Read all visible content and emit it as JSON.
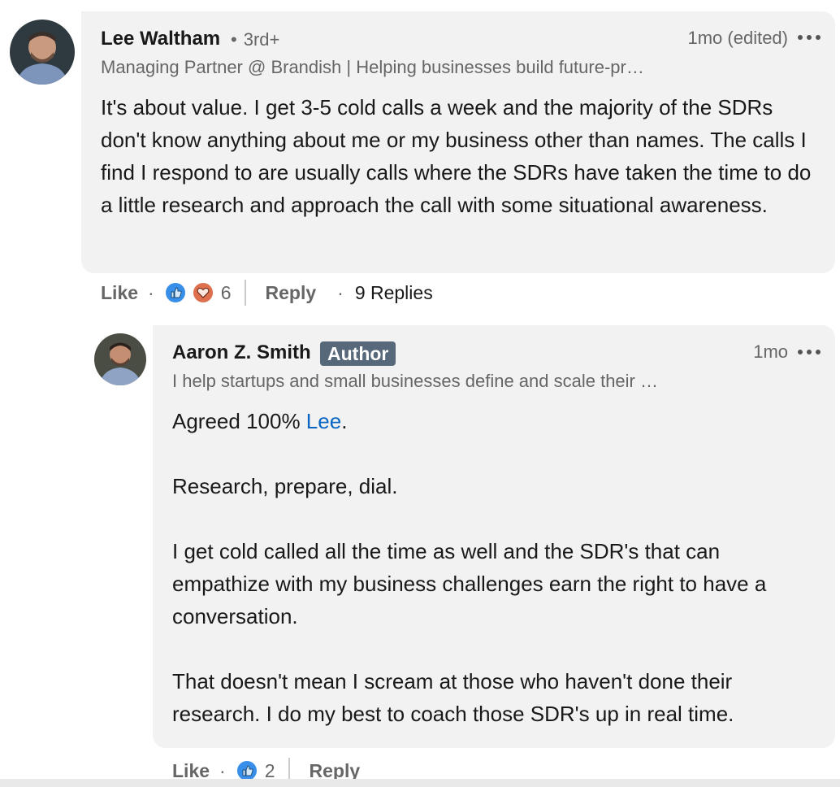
{
  "comment": {
    "author_name": "Lee Waltham",
    "degree": "3rd+",
    "time": "1mo (edited)",
    "headline": "Managing Partner @ Brandish | Helping businesses build future-pr…",
    "text": "It's about value. I get 3-5 cold calls a week and the majority of the SDRs don't know anything about me or my business other than names. The calls I find I respond to are usually calls where the SDRs have taken the time to do a little research and approach the call with some situational awareness.",
    "actions": {
      "like_label": "Like",
      "reaction_count": "6",
      "reply_label": "Reply",
      "replies_label": "9 Replies"
    }
  },
  "reply": {
    "author_name": "Aaron Z. Smith",
    "author_badge": "Author",
    "time": "1mo",
    "headline": "I help startups and small businesses define and scale their …",
    "line1_prefix": "Agreed 100% ",
    "mention": "Lee",
    "line1_suffix": ".",
    "para2": "Research, prepare, dial.",
    "para3": "I get cold called all the time as well and the SDR's that can empathize with my business challenges earn the right to have a conversation.",
    "para4": "That doesn't mean I scream at those who haven't done their research. I do my best to coach those SDR's up in real time.",
    "actions": {
      "like_label": "Like",
      "reaction_count": "2",
      "reply_label": "Reply"
    }
  },
  "colors": {
    "bubble": "#f2f2f2",
    "link": "#0a66c2",
    "like_blue": "#378fe9",
    "love_red": "#df704d",
    "badge": "#56687a"
  }
}
